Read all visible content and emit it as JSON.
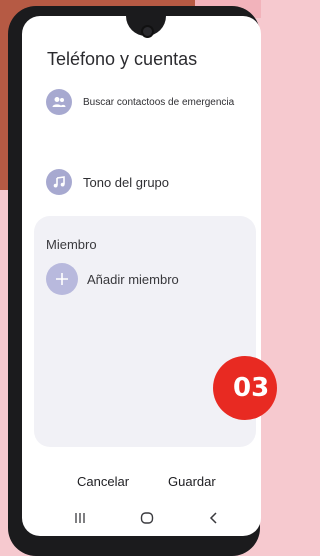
{
  "screen": {
    "title": "Teléfono y cuentas"
  },
  "rows": [
    {
      "icon": "contacts-icon",
      "label": "Buscar contactoos de emergencia"
    },
    {
      "icon": "music-note-icon",
      "label": "Tono del grupo"
    }
  ],
  "members": {
    "section_label": "Miembro",
    "add_label": "Añadir miembro"
  },
  "actions": {
    "cancel_label": "Cancelar",
    "save_label": "Guardar"
  },
  "nav": {
    "recents_icon": "recents-icon",
    "home_icon": "home-icon",
    "back_icon": "back-icon"
  },
  "overlay": {
    "badge_text": "03"
  },
  "colors": {
    "background_pink": "#f6c9cf",
    "background_brown": "#b65a44",
    "icon_lavender": "#a7a9d0",
    "card": "#f1f1f6",
    "badge_red": "#e82a22"
  }
}
